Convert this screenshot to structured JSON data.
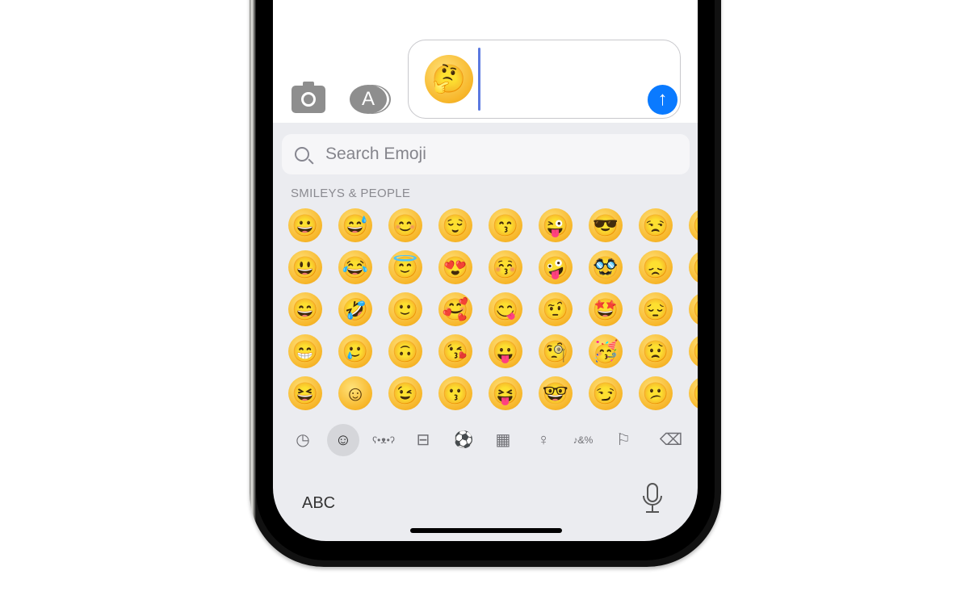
{
  "message": {
    "camera_icon": "camera",
    "apps_icon": "app-store",
    "draft": "🤔",
    "send_icon": "arrow-up",
    "send_color": "#0a7aff"
  },
  "search": {
    "placeholder": "Search Emoji"
  },
  "section_label": "SMILEYS & PEOPLE",
  "emoji_rows": [
    [
      "😀",
      "😅",
      "😊",
      "😌",
      "😙",
      "😜",
      "😎",
      "😒",
      "😛"
    ],
    [
      "😃",
      "😂",
      "😇",
      "😍",
      "😚",
      "🤪",
      "🥸",
      "😞",
      "😛"
    ],
    [
      "😄",
      "🤣",
      "🙂",
      "🥰",
      "😋",
      "🤨",
      "🤩",
      "😔",
      "😛"
    ],
    [
      "😁",
      "🥲",
      "🙃",
      "😘",
      "😛",
      "🧐",
      "🥳",
      "😟",
      "😛"
    ],
    [
      "😆",
      "☺",
      "😉",
      "😗",
      "😝",
      "🤓",
      "😏",
      "😕",
      "😛"
    ]
  ],
  "categories": [
    {
      "name": "recent",
      "glyph": "◷"
    },
    {
      "name": "smileys",
      "glyph": "☺",
      "selected": true
    },
    {
      "name": "animals",
      "glyph": "ʕ•ᴥ•ʔ"
    },
    {
      "name": "food",
      "glyph": "⊟"
    },
    {
      "name": "activity",
      "glyph": "⚽"
    },
    {
      "name": "travel",
      "glyph": "▦"
    },
    {
      "name": "objects",
      "glyph": "♀"
    },
    {
      "name": "symbols",
      "glyph": "♪&%"
    },
    {
      "name": "flags",
      "glyph": "⚐"
    },
    {
      "name": "delete",
      "glyph": "⌫"
    }
  ],
  "keyboard": {
    "abc_label": "ABC",
    "mic_icon": "microphone"
  }
}
